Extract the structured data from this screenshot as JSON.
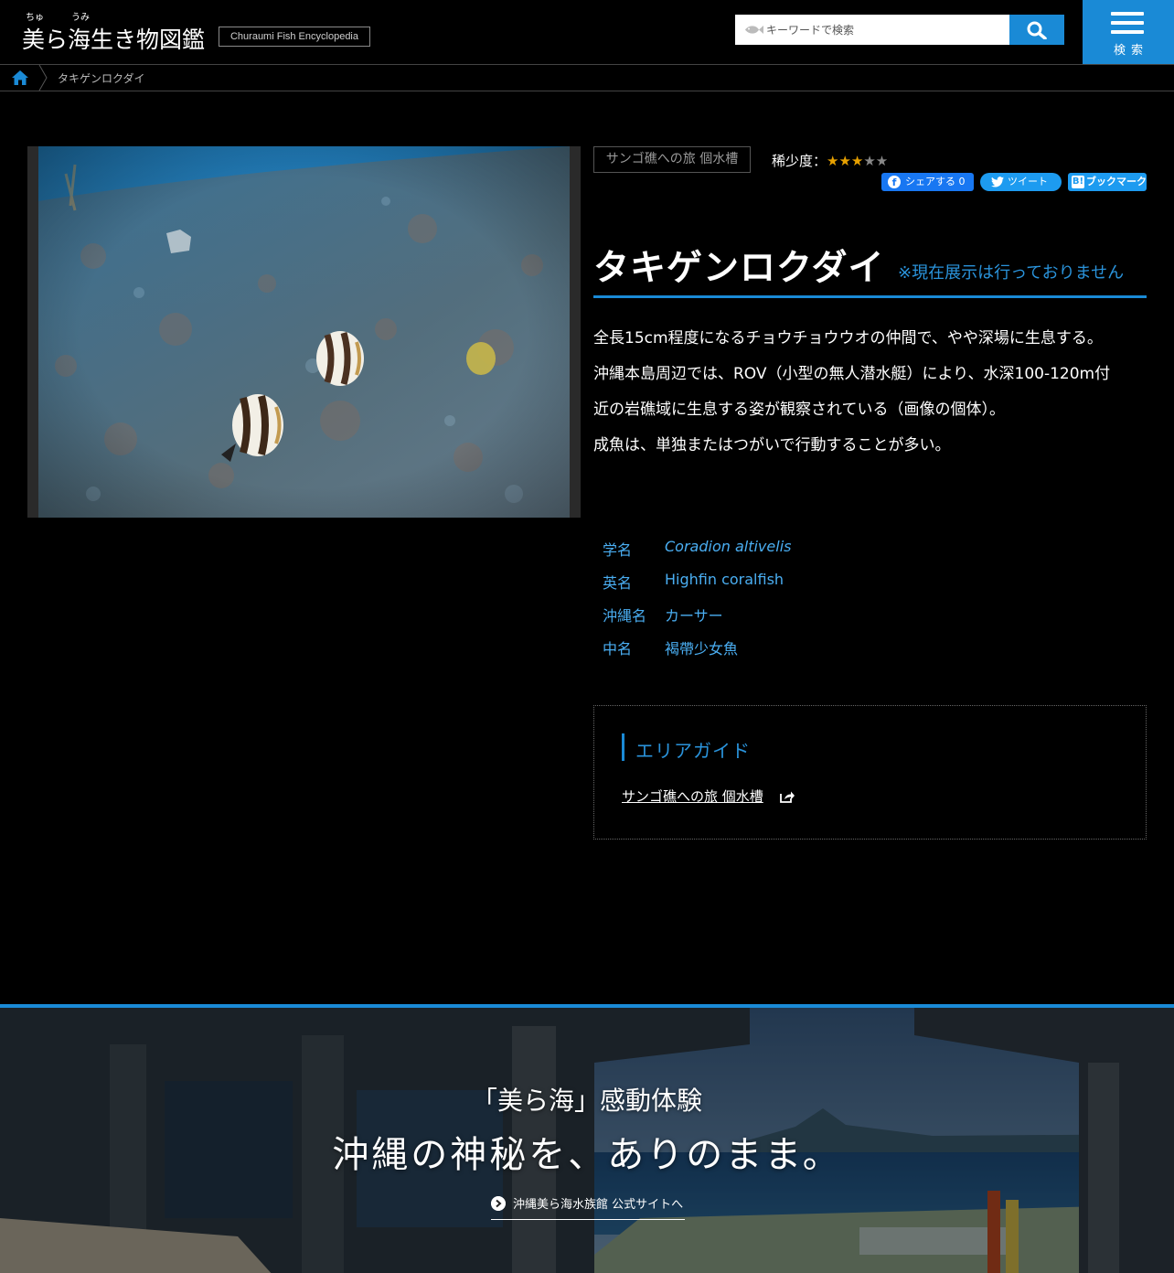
{
  "header": {
    "logo_ruby_1": "ちゅ",
    "logo_ruby_2": "うみ",
    "logo_title": "美ら海生き物図鑑",
    "logo_subtitle": "Churaumi Fish Encyclopedia",
    "search_placeholder": "キーワードで検索",
    "menu_label": "検索",
    "accent_color": "#1a8ad6"
  },
  "breadcrumb": {
    "home_icon": "home-icon",
    "current": "タキゲンロクダイ"
  },
  "fish": {
    "area_tag": "サンゴ礁への旅 個水槽",
    "rarity_label": "稀少度：",
    "rarity_stars_filled": "★★★",
    "rarity_stars_empty": "★★",
    "rarity_value": 3,
    "rarity_max": 5,
    "name": "タキゲンロクダイ",
    "exhibit_note": "※現在展示は行っておりません",
    "description": [
      "全長15cm程度になるチョウチョウウオの仲間で、やや深場に生息する。",
      "沖縄本島周辺では、ROV（小型の無人潜水艇）により、水深100-120m付",
      "近の岩礁域に生息する姿が観察されている（画像の個体）。",
      "成魚は、単独またはつがいで行動することが多い。"
    ],
    "names": [
      {
        "key": "学名",
        "value": "Coradion altivelis"
      },
      {
        "key": "英名",
        "value": "Highfin coralfish"
      },
      {
        "key": "沖縄名",
        "value": "カーサー"
      },
      {
        "key": "中名",
        "value": "褐帶少女魚"
      }
    ]
  },
  "share": {
    "facebook": "シェアする 0",
    "twitter": "ツイート",
    "hatena_mark": "B!",
    "hatena": "ブックマーク"
  },
  "area_guide": {
    "title": "エリアガイド",
    "link": "サンゴ礁への旅 個水槽"
  },
  "banner": {
    "subtitle": "「美ら海」感動体験",
    "title": "沖縄の神秘を、ありのまま。",
    "link": "沖縄美ら海水族館 公式サイトへ"
  }
}
